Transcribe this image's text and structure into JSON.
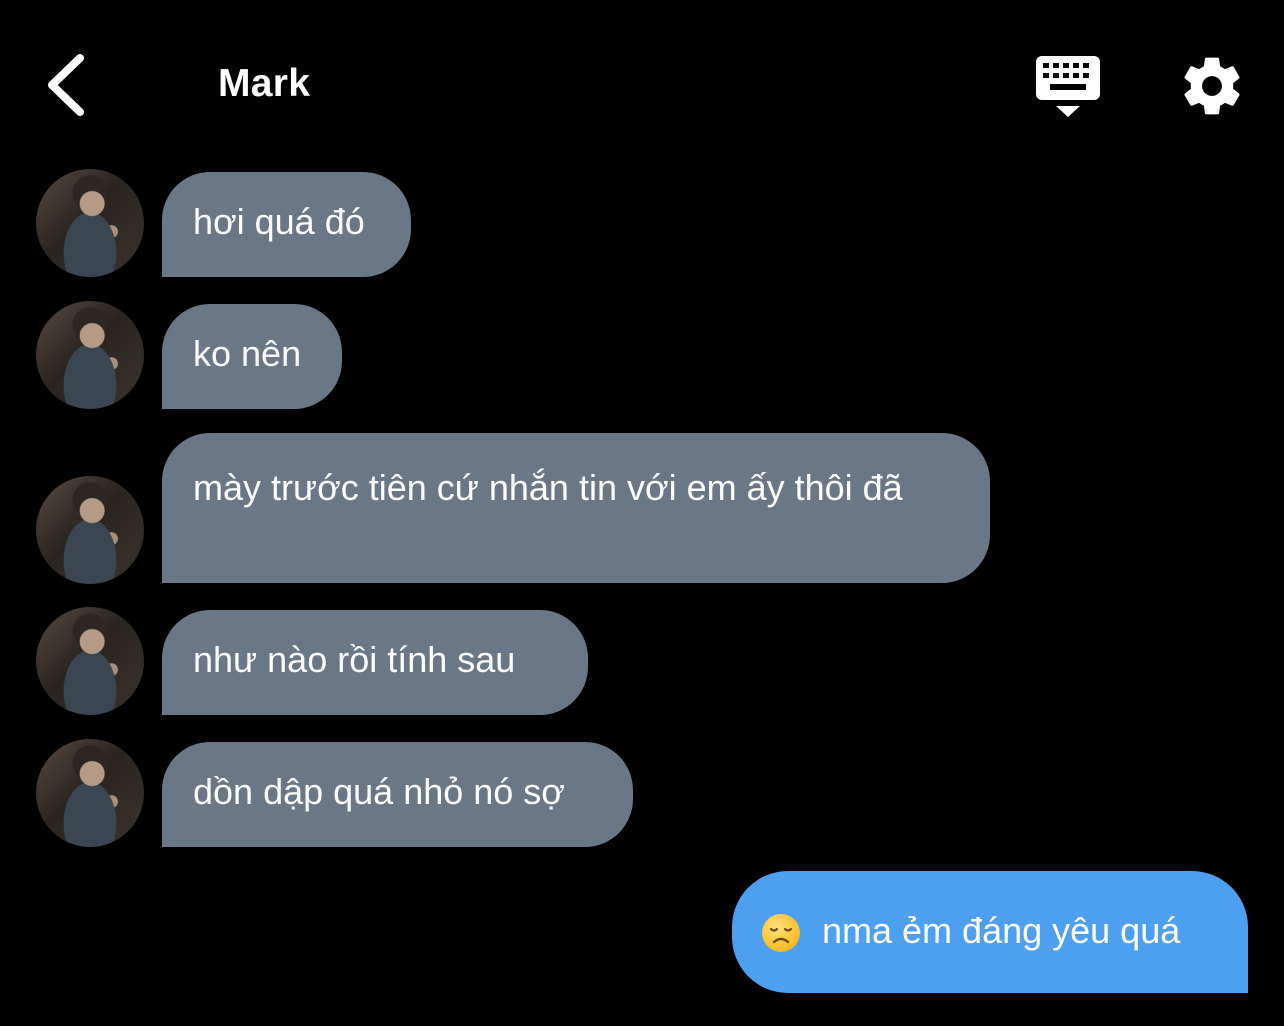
{
  "header": {
    "title": "Mark",
    "back_icon": "chevron-left-icon",
    "keyboard_icon": "keyboard-hide-icon",
    "settings_icon": "gear-icon"
  },
  "messages": [
    {
      "direction": "incoming",
      "text": "hơi quá đó"
    },
    {
      "direction": "incoming",
      "text": "ko nên"
    },
    {
      "direction": "incoming",
      "text": "mày trước tiên cứ nhắn tin với em ấy thôi đã"
    },
    {
      "direction": "incoming",
      "text": "như nào rồi tính sau"
    },
    {
      "direction": "incoming",
      "text": "dồn dập quá nhỏ nó sợ"
    },
    {
      "direction": "outgoing",
      "emoji": "disappointed-face-emoji",
      "text": "nma ẻm đáng yêu quá"
    }
  ],
  "colors": {
    "background": "#000000",
    "incoming_bubble": "#697786",
    "outgoing_bubble": "#4d9ff0",
    "text": "#ffffff"
  }
}
